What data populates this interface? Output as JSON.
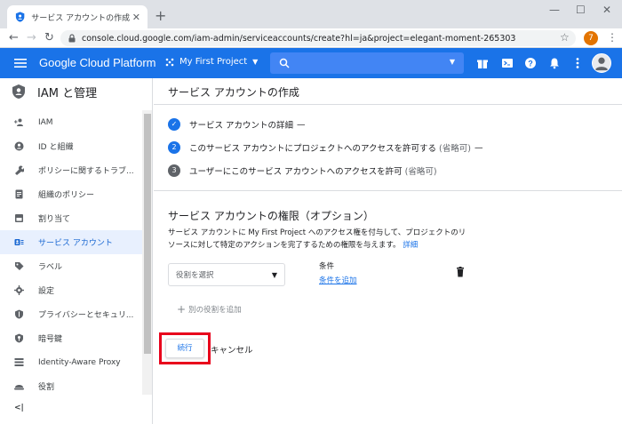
{
  "browser": {
    "tab_title": "サービス アカウントの作成 – IAM と管",
    "tab_close": "✕",
    "new_tab": "+",
    "url": "console.cloud.google.com/iam-admin/serviceaccounts/create?hl=ja&project=elegant-moment-265303",
    "profile_initial": "7",
    "icons": [
      "back-icon",
      "forward-icon",
      "reload-icon",
      "lock-icon",
      "star-icon",
      "menu-icon"
    ]
  },
  "header": {
    "brand": "Google Cloud Platform",
    "project": "My First Project",
    "accent": "#1a73e8",
    "icons": [
      "hamburger-icon",
      "search-icon",
      "gift-icon",
      "terminal-icon",
      "help-icon",
      "bell-icon",
      "kebab-icon",
      "avatar"
    ]
  },
  "sidebar": {
    "title": "IAM と管理",
    "items": [
      {
        "label": "IAM",
        "icon": "person-add-icon"
      },
      {
        "label": "ID と組織",
        "icon": "account-circle-icon"
      },
      {
        "label": "ポリシーに関するトラブ...",
        "icon": "wrench-icon"
      },
      {
        "label": "組織のポリシー",
        "icon": "document-icon"
      },
      {
        "label": "割り当て",
        "icon": "quota-icon"
      },
      {
        "label": "サービス アカウント",
        "icon": "service-account-icon",
        "active": true
      },
      {
        "label": "ラベル",
        "icon": "label-icon"
      },
      {
        "label": "設定",
        "icon": "gear-icon"
      },
      {
        "label": "プライバシーとセキュリ...",
        "icon": "shield-icon"
      },
      {
        "label": "暗号鍵",
        "icon": "key-shield-icon"
      },
      {
        "label": "Identity-Aware Proxy",
        "icon": "iap-icon"
      },
      {
        "label": "役割",
        "icon": "hat-icon"
      }
    ],
    "collapse": "<|"
  },
  "main": {
    "title": "サービス アカウントの作成",
    "steps": [
      {
        "marker": "✓",
        "label": "サービス アカウントの詳細",
        "suffix": "—",
        "optional": ""
      },
      {
        "marker": "2",
        "label": "このサービス アカウントにプロジェクトへのアクセスを許可する",
        "optional": "(省略可)",
        "suffix": "—"
      },
      {
        "marker": "3",
        "label": "ユーザーにこのサービス アカウントへのアクセスを許可",
        "optional": "(省略可)",
        "suffix": ""
      }
    ],
    "section_title": "サービス アカウントの権限（オプション）",
    "description": "サービス アカウントに My First Project へのアクセス権を付与して、プロジェクトのリソースに対して特定のアクションを完了するための権限を与えます。",
    "description_link": "詳細",
    "role_select_placeholder": "役割を選択",
    "condition_label": "条件",
    "condition_link": "条件を追加",
    "add_role": "別の役割を追加",
    "continue": "続行",
    "cancel": "キャンセル"
  }
}
